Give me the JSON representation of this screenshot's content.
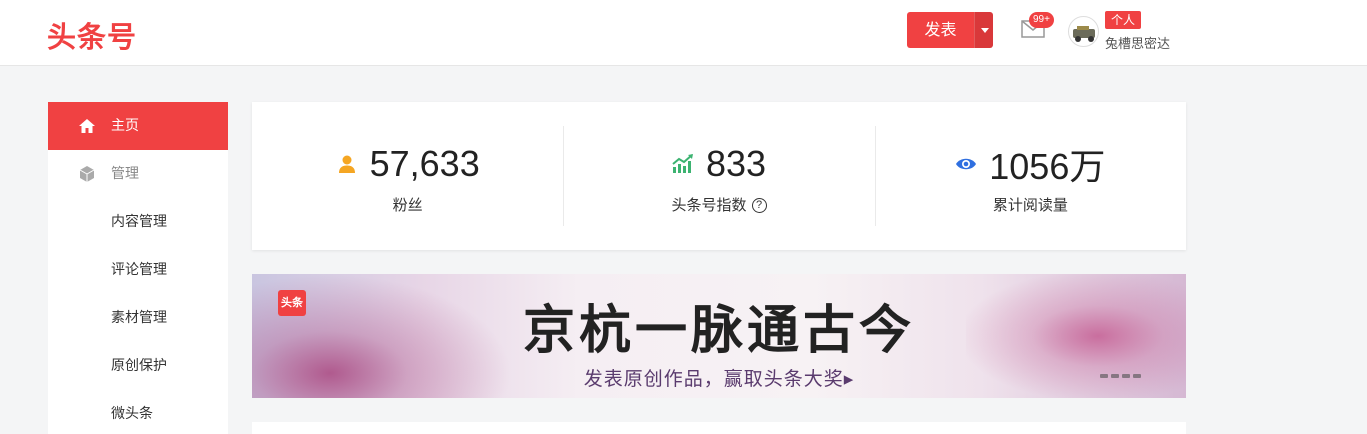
{
  "header": {
    "logo": "头条号",
    "publish_label": "发表",
    "mail_badge": "99+",
    "role_badge": "个人",
    "username": "兔槽思密达"
  },
  "sidebar": {
    "items": [
      {
        "label": "主页",
        "icon": "home-icon",
        "active": true
      },
      {
        "label": "管理",
        "icon": "cube-icon",
        "parent": true
      },
      {
        "label": "内容管理"
      },
      {
        "label": "评论管理"
      },
      {
        "label": "素材管理"
      },
      {
        "label": "原创保护"
      },
      {
        "label": "微头条"
      }
    ]
  },
  "stats": [
    {
      "value": "57,633",
      "label": "粉丝",
      "icon": "user-icon",
      "color": "#f5a623"
    },
    {
      "value": "833",
      "label": "头条号指数",
      "icon": "trend-icon",
      "color": "#3cb371",
      "help": "?"
    },
    {
      "value": "1056万",
      "label": "累计阅读量",
      "icon": "eye-icon",
      "color": "#2f6fe0"
    }
  ],
  "banner": {
    "tag": "头条",
    "title": "京杭一脉通古今",
    "subtitle": "发表原创作品，赢取头条大奖▸"
  },
  "colors": {
    "brand": "#f04142",
    "background": "#f4f5f6"
  }
}
